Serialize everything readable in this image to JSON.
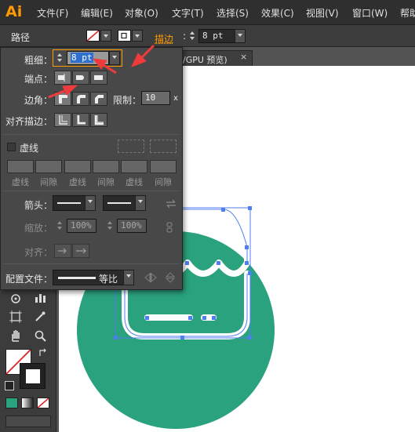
{
  "app": {
    "logo": "Ai"
  },
  "menu": [
    "文件(F)",
    "编辑(E)",
    "对象(O)",
    "文字(T)",
    "选择(S)",
    "效果(C)",
    "视图(V)",
    "窗口(W)",
    "帮助"
  ],
  "control_bar": {
    "title": "路径",
    "stroke_label": "描边",
    "stroke_value": "8 pt"
  },
  "document_tab": {
    "label": "/GPU 预览)",
    "close": "×"
  },
  "stroke_panel": {
    "weight_label": "粗细：",
    "weight_value": "8 pt",
    "cap_label": "端点：",
    "corner_label": "边角：",
    "limit_label": "限制：",
    "limit_value": "10",
    "limit_unit": "x",
    "align_label": "对齐描边：",
    "dashed_label": "虚线",
    "dash_labels": [
      "虚线",
      "间隙",
      "虚线",
      "间隙",
      "虚线",
      "间隙"
    ],
    "arrow_label": "箭头：",
    "scale_label": "缩放：",
    "scale_start": "100%",
    "scale_end": "100%",
    "align_arrow_label": "对齐：",
    "profile_label": "配置文件：",
    "profile_value": "等比"
  },
  "colors": {
    "accent": "#ff9a00",
    "circle": "#2aa27d",
    "selection": "#4f7ef0",
    "annotation_arrow": "#ef3b3b"
  },
  "icons": [
    "stroke-none-icon",
    "fill-white-icon",
    "cap-butt-icon",
    "cap-round-icon",
    "cap-square-icon",
    "join-miter-icon",
    "join-round-icon",
    "join-bevel-icon",
    "align-center-icon",
    "align-inside-icon",
    "align-outside-icon",
    "swap-arrows-icon",
    "link-icon",
    "flip-icon"
  ]
}
